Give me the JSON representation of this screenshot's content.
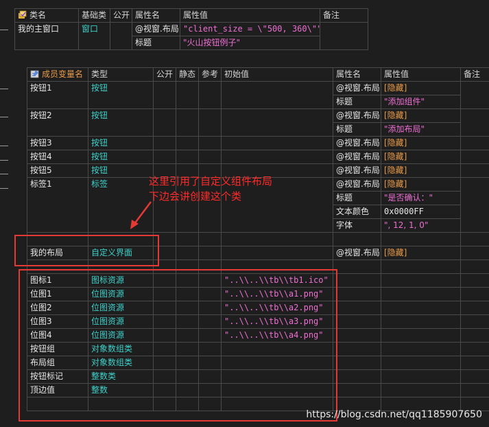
{
  "window_table": {
    "headers": [
      "类名",
      "基础类",
      "公开",
      "属性名",
      "属性值",
      "备注"
    ],
    "row": {
      "name": "我的主窗口",
      "base": "窗口",
      "public": ""
    },
    "props": [
      {
        "name": "@视窗.布局",
        "value": "\"client_size = \\\"500, 360\\\"\""
      },
      {
        "name": "标题",
        "value": "\"火山按钮例子\""
      }
    ]
  },
  "member_table": {
    "headers": [
      "成员变量名",
      "类型",
      "公开",
      "静态",
      "参考",
      "初始值",
      "属性名",
      "属性值",
      "备注"
    ],
    "rows": [
      {
        "name": "按钮1",
        "type": "按钮",
        "init": "",
        "props": [
          {
            "name": "@视窗.布局",
            "value": "[隐藏]"
          },
          {
            "name": "标题",
            "value": "\"添加组件\""
          }
        ]
      },
      {
        "name": "按钮2",
        "type": "按钮",
        "init": "",
        "props": [
          {
            "name": "@视窗.布局",
            "value": "[隐藏]"
          },
          {
            "name": "标题",
            "value": "\"添加布局\""
          }
        ]
      },
      {
        "name": "按钮3",
        "type": "按钮",
        "init": "",
        "props": [
          {
            "name": "@视窗.布局",
            "value": "[隐藏]"
          }
        ]
      },
      {
        "name": "按钮4",
        "type": "按钮",
        "init": "",
        "props": [
          {
            "name": "@视窗.布局",
            "value": "[隐藏]"
          }
        ]
      },
      {
        "name": "按钮5",
        "type": "按钮",
        "init": "",
        "props": [
          {
            "name": "@视窗.布局",
            "value": "[隐藏]"
          }
        ]
      },
      {
        "name": "标签1",
        "type": "标签",
        "init": "",
        "props": [
          {
            "name": "@视窗.布局",
            "value": "[隐藏]"
          },
          {
            "name": "标题",
            "value": "\"是否确认：\""
          },
          {
            "name": "文本颜色",
            "value": "0x0000FF"
          },
          {
            "name": "字体",
            "value": "\", 12, 1, 0\""
          }
        ]
      },
      {
        "name": "我的布局",
        "type": "自定义界面",
        "init": "",
        "props": [
          {
            "name": "@视窗.布局",
            "value": "[隐藏]"
          }
        ]
      },
      {
        "name": "图标1",
        "type": "图标资源",
        "init": "\"..\\\\..\\\\tb\\\\tb1.ico\""
      },
      {
        "name": "位图1",
        "type": "位图资源",
        "init": "\"..\\\\..\\\\tb\\\\a1.png\""
      },
      {
        "name": "位图2",
        "type": "位图资源",
        "init": "\"..\\\\..\\\\tb\\\\a2.png\""
      },
      {
        "name": "位图3",
        "type": "位图资源",
        "init": "\"..\\\\..\\\\tb\\\\a3.png\""
      },
      {
        "name": "位图4",
        "type": "位图资源",
        "init": "\"..\\\\..\\\\tb\\\\a4.png\""
      },
      {
        "name": "按钮组",
        "type": "对象数组类",
        "init": ""
      },
      {
        "name": "布局组",
        "type": "对象数组类",
        "init": ""
      },
      {
        "name": "按钮标记",
        "type": "整数类",
        "init": ""
      },
      {
        "name": "顶边值",
        "type": "整数",
        "init": ""
      }
    ]
  },
  "annotation": {
    "line1": "这里引用了自定义组件布局",
    "line2": "下边会讲创建这个类"
  },
  "watermark": "https://blog.csdn.net/qq1185907650",
  "colors": {
    "name": "#e6e6e6",
    "type": "#3fd0c9",
    "string": "#ee6fd4",
    "hidden": "#e89a4a",
    "annotation": "#e53935"
  },
  "icons": {
    "class_icon": "class-icon",
    "member_icon": "member-icon"
  }
}
